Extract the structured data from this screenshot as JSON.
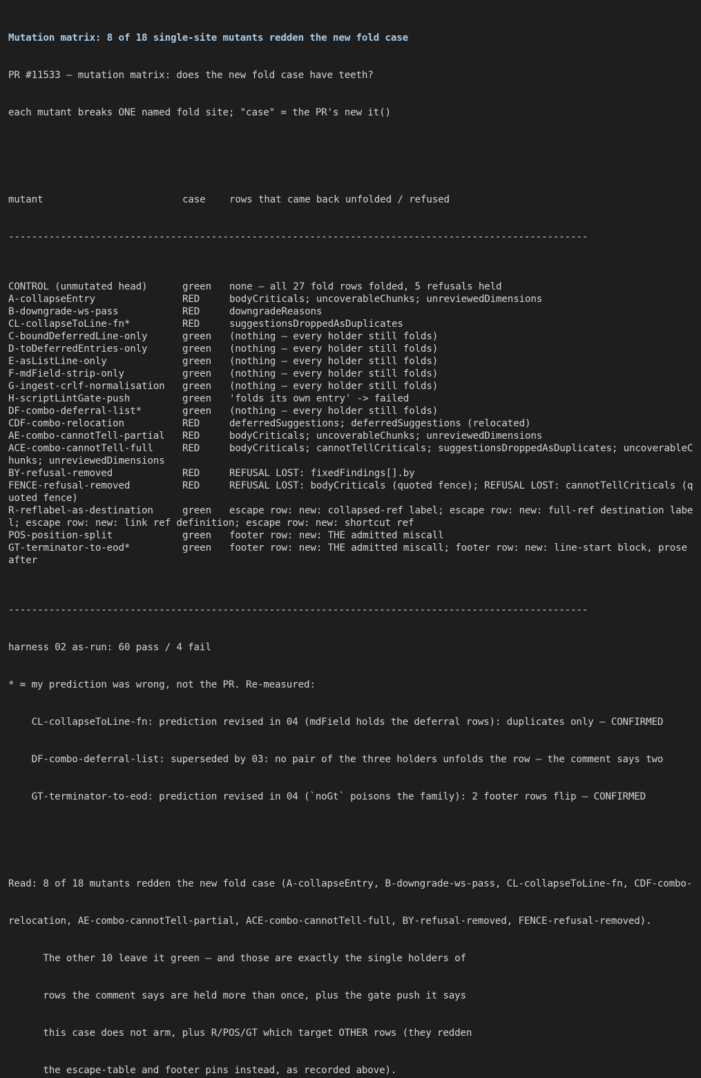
{
  "header": {
    "title": "Mutation matrix: 8 of 18 single-site mutants redden the new fold case",
    "lines": [
      "PR #11533 — mutation matrix: does the new fold case have teeth?",
      "each mutant breaks ONE named fold site; \"case\" = the PR's new it()"
    ]
  },
  "table": {
    "columns": [
      "mutant",
      "case",
      "rows that came back unfolded / refused"
    ],
    "separator": "----------------------------------------------------------------------------------------------------",
    "rows": [
      {
        "mutant": "CONTROL (unmutated head)",
        "case": "green",
        "rows": [
          "none — all 27 fold rows folded, 5 refusals held"
        ]
      },
      {
        "mutant": "A-collapseEntry",
        "case": "RED",
        "rows": [
          "bodyCriticals; uncoverableChunks; unreviewedDimensions"
        ]
      },
      {
        "mutant": "B-downgrade-ws-pass",
        "case": "RED",
        "rows": [
          "downgradeReasons"
        ]
      },
      {
        "mutant": "CL-collapseToLine-fn*",
        "case": "RED",
        "rows": [
          "suggestionsDroppedAsDuplicates"
        ]
      },
      {
        "mutant": "C-boundDeferredLine-only",
        "case": "green",
        "rows": [
          "(nothing — every holder still folds)"
        ]
      },
      {
        "mutant": "D-toDeferredEntries-only",
        "case": "green",
        "rows": [
          "(nothing — every holder still folds)"
        ]
      },
      {
        "mutant": "E-asListLine-only",
        "case": "green",
        "rows": [
          "(nothing — every holder still folds)"
        ]
      },
      {
        "mutant": "F-mdField-strip-only",
        "case": "green",
        "rows": [
          "(nothing — every holder still folds)"
        ]
      },
      {
        "mutant": "G-ingest-crlf-normalisation",
        "case": "green",
        "rows": [
          "(nothing — every holder still folds)"
        ]
      },
      {
        "mutant": "H-scriptLintGate-push",
        "case": "green",
        "rows": [
          "'folds its own entry' -> failed"
        ]
      },
      {
        "mutant": "DF-combo-deferral-list*",
        "case": "green",
        "rows": [
          "(nothing — every holder still folds)"
        ]
      },
      {
        "mutant": "CDF-combo-relocation",
        "case": "RED",
        "rows": [
          "deferredSuggestions; deferredSuggestions (relocated)"
        ]
      },
      {
        "mutant": "AE-combo-cannotTell-partial",
        "case": "RED",
        "rows": [
          "bodyCriticals; uncoverableChunks; unreviewedDimensions"
        ]
      },
      {
        "mutant": "ACE-combo-cannotTell-full",
        "case": "RED",
        "rows": [
          "bodyCriticals; cannotTellCriticals; suggestionsDroppedAsDuplicates; uncoverableC",
          "hunks; unreviewedDimensions"
        ]
      },
      {
        "mutant": "BY-refusal-removed",
        "case": "RED",
        "rows": [
          "REFUSAL LOST: fixedFindings[].by"
        ]
      },
      {
        "mutant": "FENCE-refusal-removed",
        "case": "RED",
        "rows": [
          "REFUSAL LOST: bodyCriticals (quoted fence); REFUSAL LOST: cannotTellCriticals (q",
          "uoted fence)"
        ]
      },
      {
        "mutant": "R-reflabel-as-destination",
        "case": "green",
        "rows": [
          "escape row: new: collapsed-ref label; escape row: new: full-ref destination labe",
          "l; escape row: new: link ref definition; escape row: new: shortcut ref"
        ]
      },
      {
        "mutant": "POS-position-split",
        "case": "green",
        "rows": [
          "footer row: new: THE admitted miscall"
        ]
      },
      {
        "mutant": "GT-terminator-to-eod*",
        "case": "green",
        "rows": [
          "footer row: new: THE admitted miscall; footer row: new: line-start block, prose",
          "after"
        ]
      }
    ]
  },
  "summary": {
    "harness": "harness 02 as-run: 60 pass / 4 fail",
    "note": "* = my prediction was wrong, not the PR. Re-measured:",
    "items": [
      "    CL-collapseToLine-fn: prediction revised in 04 (mdField holds the deferral rows): duplicates only — CONFIRMED",
      "    DF-combo-deferral-list: superseded by 03: no pair of the three holders unfolds the row — the comment says two",
      "    GT-terminator-to-eod: prediction revised in 04 (`noGt` poisons the family): 2 footer rows flip — CONFIRMED"
    ]
  },
  "read": {
    "lines": [
      "Read: 8 of 18 mutants redden the new fold case (A-collapseEntry, B-downgrade-ws-pass, CL-collapseToLine-fn, CDF-combo-",
      "relocation, AE-combo-cannotTell-partial, ACE-combo-cannotTell-full, BY-refusal-removed, FENCE-refusal-removed).",
      "      The other 10 leave it green — and those are exactly the single holders of",
      "      rows the comment says are held more than once, plus the gate push it says",
      "      this case does not arm, plus R/POS/GT which target OTHER rows (they redden",
      "      the escape-table and footer pins instead, as recorded above)."
    ]
  }
}
